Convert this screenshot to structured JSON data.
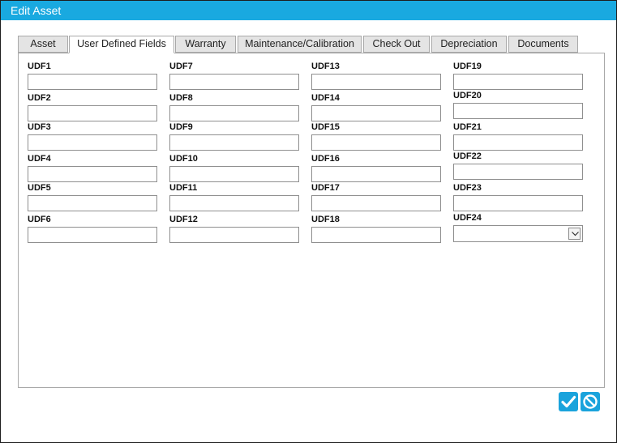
{
  "window": {
    "title": "Edit Asset"
  },
  "tabs": [
    {
      "label": "Asset",
      "active": false
    },
    {
      "label": "User Defined Fields",
      "active": true
    },
    {
      "label": "Warranty",
      "active": false
    },
    {
      "label": "Maintenance/Calibration",
      "active": false
    },
    {
      "label": "Check Out",
      "active": false
    },
    {
      "label": "Depreciation",
      "active": false
    },
    {
      "label": "Documents",
      "active": false
    }
  ],
  "fields": [
    {
      "label": "UDF1",
      "value": ""
    },
    {
      "label": "UDF2",
      "value": ""
    },
    {
      "label": "UDF3",
      "value": ""
    },
    {
      "label": "UDF4",
      "value": ""
    },
    {
      "label": "UDF5",
      "value": ""
    },
    {
      "label": "UDF6",
      "value": ""
    },
    {
      "label": "UDF7",
      "value": ""
    },
    {
      "label": "UDF8",
      "value": ""
    },
    {
      "label": "UDF9",
      "value": ""
    },
    {
      "label": "UDF10",
      "value": ""
    },
    {
      "label": "UDF11",
      "value": ""
    },
    {
      "label": "UDF12",
      "value": ""
    },
    {
      "label": "UDF13",
      "value": ""
    },
    {
      "label": "UDF14",
      "value": ""
    },
    {
      "label": "UDF15",
      "value": ""
    },
    {
      "label": "UDF16",
      "value": ""
    },
    {
      "label": "UDF17",
      "value": ""
    },
    {
      "label": "UDF18",
      "value": ""
    },
    {
      "label": "UDF19",
      "value": ""
    },
    {
      "label": "UDF20",
      "value": ""
    },
    {
      "label": "UDF21",
      "value": ""
    },
    {
      "label": "UDF22",
      "value": ""
    },
    {
      "label": "UDF23",
      "value": ""
    },
    {
      "label": "UDF24",
      "value": ""
    }
  ],
  "actions": {
    "save_icon": "checkmark-icon",
    "cancel_icon": "cancel-icon"
  },
  "colors": {
    "accent": "#19a9e0",
    "border": "#a9a9a9",
    "tab_inactive": "#e4e4e4"
  }
}
